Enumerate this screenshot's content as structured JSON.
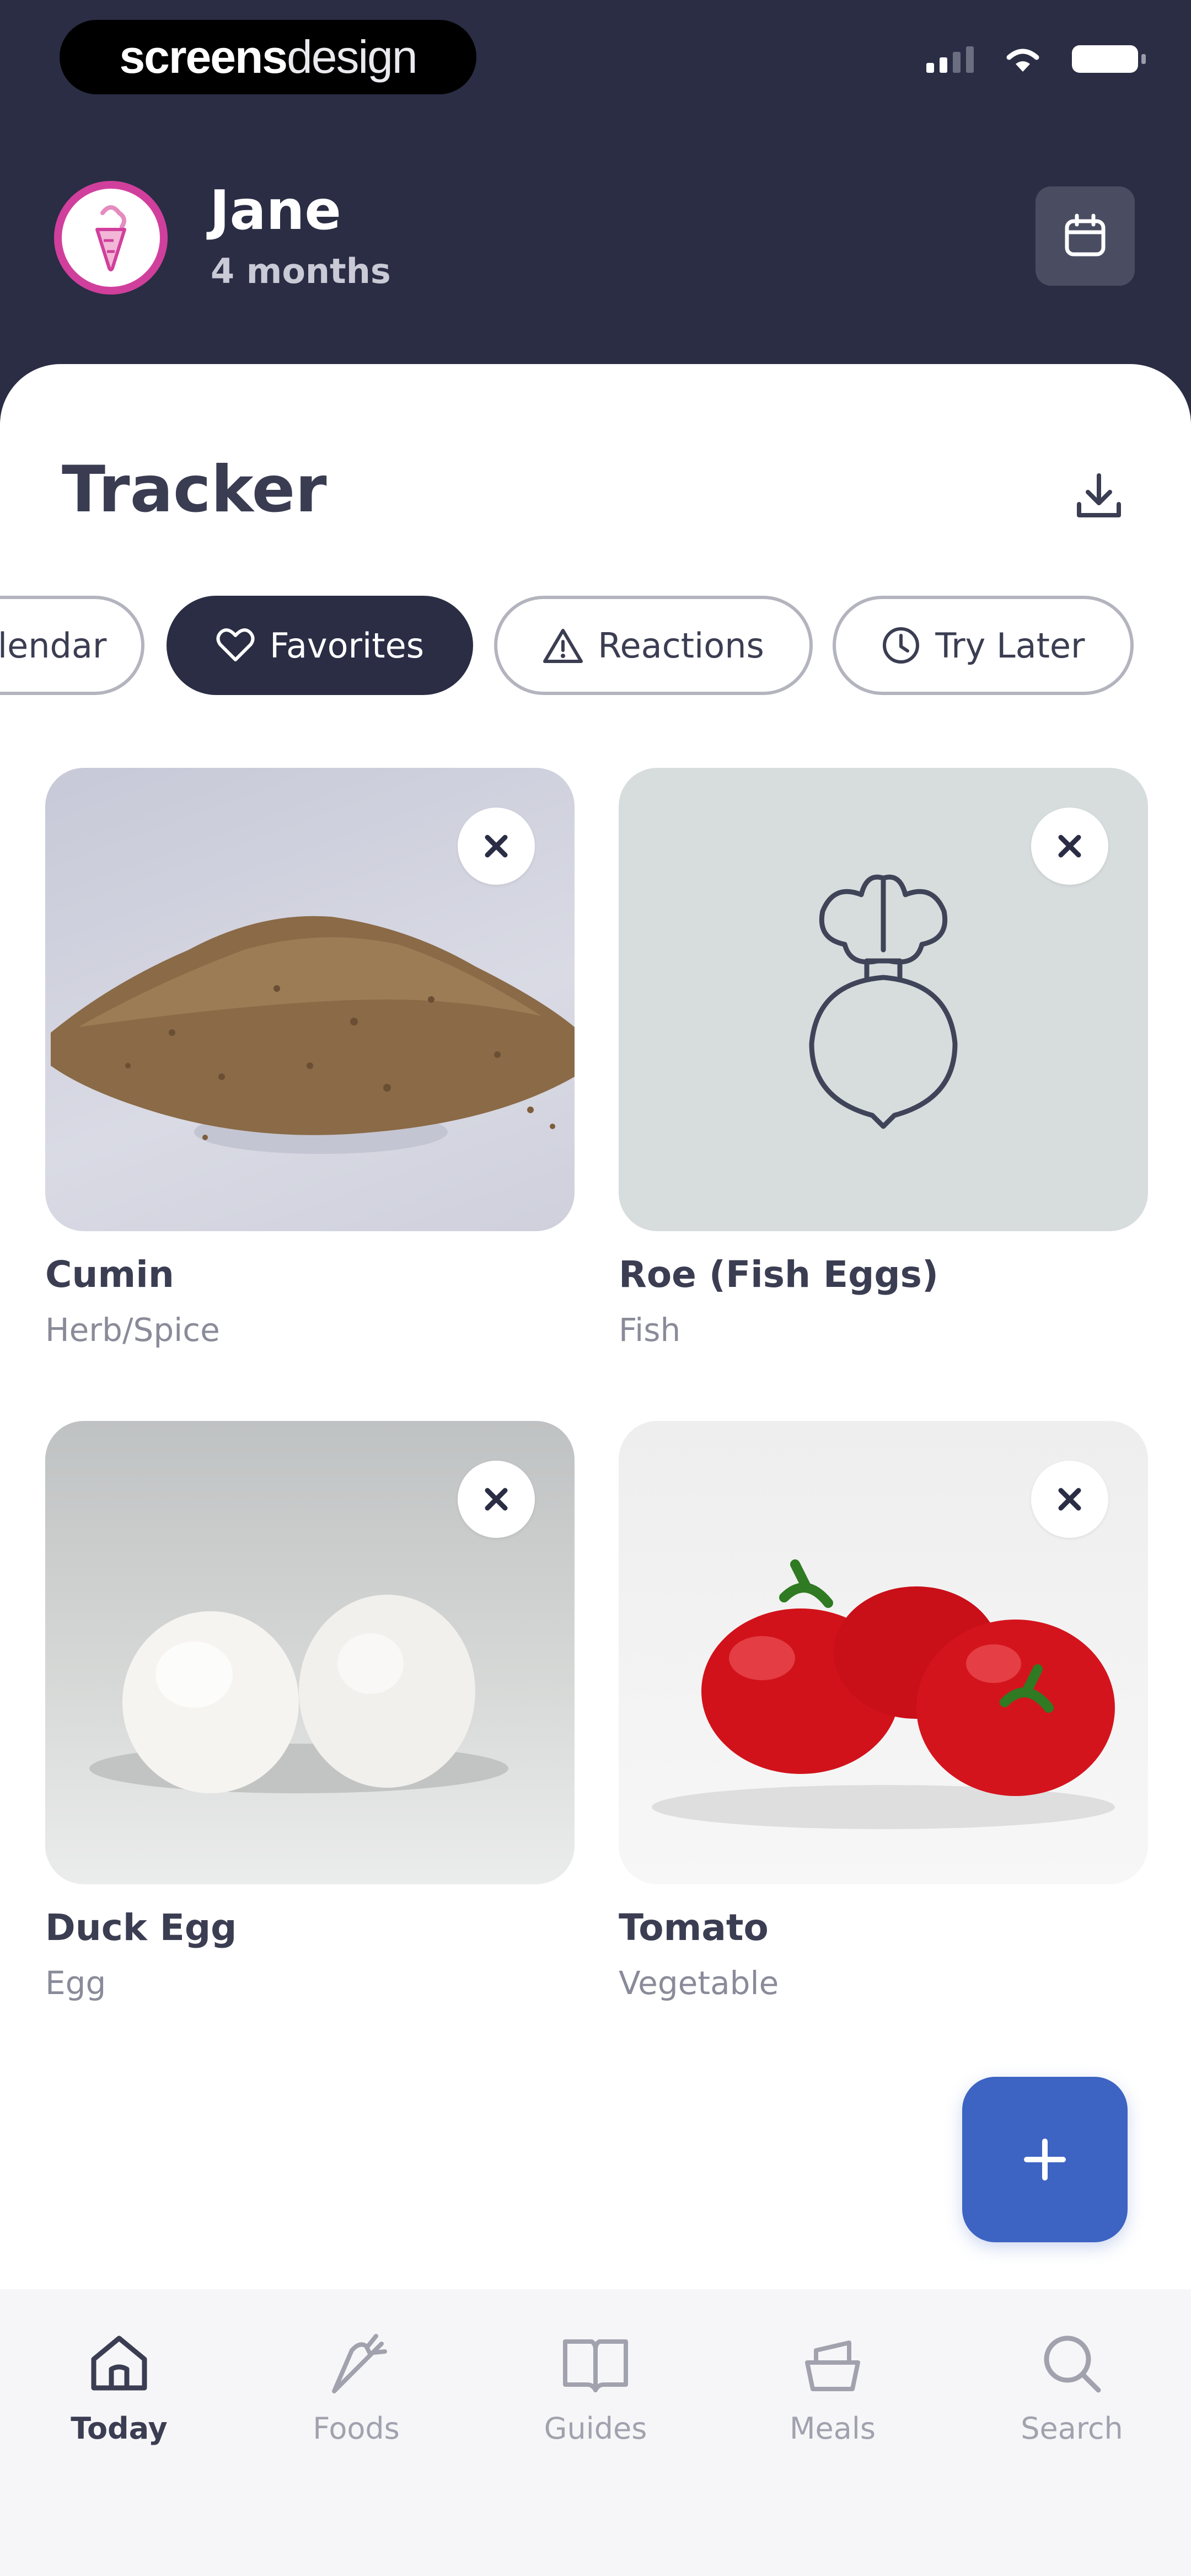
{
  "status_bar": {
    "brand_bold": "screens",
    "brand_light": "design"
  },
  "profile": {
    "name": "Jane",
    "age": "4 months"
  },
  "page": {
    "title": "Tracker"
  },
  "filters": [
    {
      "label": "Calendar",
      "icon": "calendar-icon",
      "active": false
    },
    {
      "label": "Favorites",
      "icon": "heart-icon",
      "active": true
    },
    {
      "label": "Reactions",
      "icon": "warning-icon",
      "active": false
    },
    {
      "label": "Try Later",
      "icon": "clock-icon",
      "active": false
    }
  ],
  "foods": [
    {
      "name": "Cumin",
      "category": "Herb/Spice",
      "image": "cumin-photo"
    },
    {
      "name": "Roe (Fish Eggs)",
      "category": "Fish",
      "image": "beet-placeholder-icon"
    },
    {
      "name": "Duck Egg",
      "category": "Egg",
      "image": "duck-egg-photo"
    },
    {
      "name": "Tomato",
      "category": "Vegetable",
      "image": "tomato-photo"
    }
  ],
  "fab": {
    "icon": "plus-icon"
  },
  "tabs": [
    {
      "label": "Today",
      "icon": "home-icon",
      "active": true
    },
    {
      "label": "Foods",
      "icon": "carrot-icon",
      "active": false
    },
    {
      "label": "Guides",
      "icon": "book-icon",
      "active": false
    },
    {
      "label": "Meals",
      "icon": "bowl-icon",
      "active": false
    },
    {
      "label": "Search",
      "icon": "search-icon",
      "active": false
    }
  ],
  "colors": {
    "header_bg": "#2a2d44",
    "avatar_ring": "#d13f9c",
    "fab_bg": "#3d63c3",
    "chip_active_bg": "#2a2d44"
  }
}
